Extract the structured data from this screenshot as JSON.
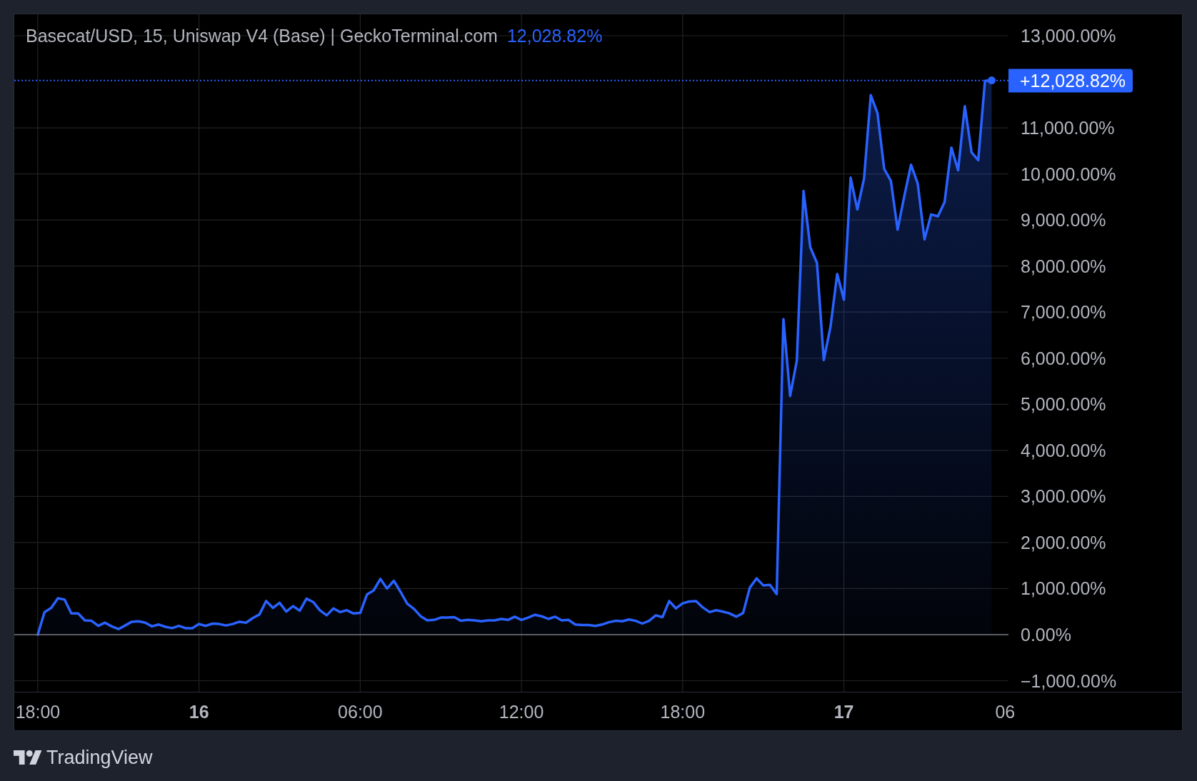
{
  "chart": {
    "legend_value": "12,028.82%",
    "xtick_bold": [
      false,
      true,
      false,
      false,
      false,
      true,
      false
    ],
    "chart_data": {
      "type": "area",
      "title": "Basecat/USD, 15, Uniswap V4 (Base) | GeckoTerminal.com",
      "grid": true,
      "categories": [
        null,
        null,
        null,
        "18:00",
        null,
        null,
        null,
        null,
        null,
        null,
        null,
        null,
        null,
        null,
        null,
        null,
        null,
        null,
        null,
        null,
        null,
        null,
        null,
        null,
        null,
        null,
        null,
        "16",
        null,
        null,
        null,
        null,
        null,
        null,
        null,
        null,
        null,
        null,
        null,
        null,
        null,
        null,
        null,
        null,
        null,
        null,
        null,
        null,
        null,
        null,
        null,
        "06:00",
        null,
        null,
        null,
        null,
        null,
        null,
        null,
        null,
        null,
        null,
        null,
        null,
        null,
        null,
        null,
        null,
        null,
        null,
        null,
        null,
        null,
        null,
        null,
        "12:00",
        null,
        null,
        null,
        null,
        null,
        null,
        null,
        null,
        null,
        null,
        null,
        null,
        null,
        null,
        null,
        null,
        null,
        null,
        null,
        null,
        null,
        null,
        null,
        "18:00",
        null,
        null,
        null,
        null,
        null,
        null,
        null,
        null,
        null,
        null,
        null,
        null,
        null,
        null,
        null,
        null,
        null,
        null,
        null,
        null,
        null,
        null,
        null,
        "17",
        null,
        null,
        null,
        null,
        null,
        null,
        null,
        null,
        null,
        null,
        null,
        null,
        null,
        null,
        null,
        null,
        null,
        null,
        null,
        null,
        null,
        null,
        null,
        "06"
      ],
      "series": [
        {
          "color": "#2962ff",
          "values": [
            null,
            null,
            null,
            0,
            490,
            580,
            790,
            760,
            460,
            460,
            310,
            300,
            190,
            260,
            180,
            120,
            200,
            280,
            290,
            260,
            180,
            220,
            170,
            140,
            190,
            140,
            140,
            230,
            190,
            240,
            230,
            200,
            230,
            280,
            260,
            360,
            440,
            730,
            580,
            690,
            500,
            620,
            520,
            780,
            710,
            530,
            420,
            570,
            490,
            530,
            460,
            470,
            870,
            960,
            1210,
            1000,
            1170,
            930,
            670,
            560,
            400,
            310,
            320,
            370,
            370,
            380,
            300,
            320,
            310,
            290,
            310,
            310,
            340,
            320,
            390,
            320,
            370,
            430,
            400,
            340,
            390,
            310,
            320,
            220,
            210,
            210,
            190,
            220,
            270,
            300,
            290,
            330,
            300,
            240,
            300,
            420,
            380,
            730,
            570,
            680,
            720,
            730,
            590,
            490,
            530,
            500,
            460,
            390,
            470,
            1020,
            1220,
            1070,
            1080,
            880,
            6850,
            5180,
            5950,
            9630,
            8410,
            8070,
            5960,
            6680,
            7830,
            7270,
            9920,
            9230,
            9900,
            11710,
            11320,
            10110,
            9850,
            8790,
            9520,
            10200,
            9790,
            8580,
            9120,
            9080,
            9390,
            10570,
            10080,
            11470,
            10470,
            10300,
            12020,
            12030,
            null,
            null
          ]
        }
      ],
      "ylim": [
        -1240,
        13465
      ],
      "yticks": [
        {
          "value": 13000,
          "label": "13,000.00%"
        },
        {
          "value": 11000,
          "label": "11,000.00%"
        },
        {
          "value": 10000,
          "label": "10,000.00%"
        },
        {
          "value": 9000,
          "label": "9,000.00%"
        },
        {
          "value": 8000,
          "label": "8,000.00%"
        },
        {
          "value": 7000,
          "label": "7,000.00%"
        },
        {
          "value": 6000,
          "label": "6,000.00%"
        },
        {
          "value": 5000,
          "label": "5,000.00%"
        },
        {
          "value": 4000,
          "label": "4,000.00%"
        },
        {
          "value": 3000,
          "label": "3,000.00%"
        },
        {
          "value": 2000,
          "label": "2,000.00%"
        },
        {
          "value": 1000,
          "label": "1,000.00%"
        },
        {
          "value": 0,
          "label": "0.00%"
        },
        {
          "value": -1000,
          "label": "−1,000.00%"
        }
      ],
      "ref_lines": [
        {
          "axis": "y",
          "value": 12028.82,
          "label": "+12,028.82%"
        }
      ]
    }
  },
  "footer": {
    "brand": "TradingView"
  }
}
